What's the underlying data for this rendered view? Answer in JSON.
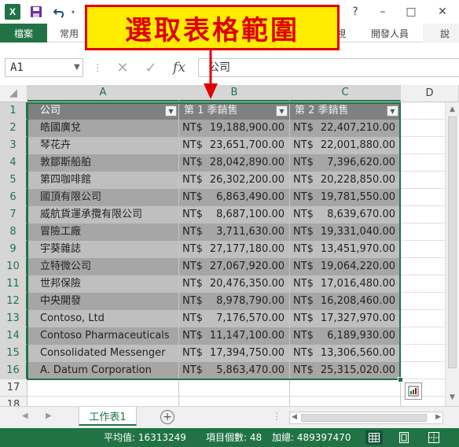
{
  "titlebar": {
    "logo": "X",
    "help": "?",
    "minimize": "–",
    "restore": "□",
    "close": "✕"
  },
  "ribbon": {
    "tabs": {
      "file": "檔案",
      "home": "常用",
      "view": "視",
      "developer": "開發人員",
      "last": "說"
    }
  },
  "callout": {
    "text": "選取表格範圍",
    "color": "#e00000",
    "background": "#ffed00"
  },
  "formula_bar": {
    "name_box": "A1",
    "formula": "公司",
    "cancel": "✕",
    "enter": "✓",
    "fx": "fx"
  },
  "columns": [
    "A",
    "B",
    "C",
    "D"
  ],
  "table": {
    "headers": [
      "公司",
      "第 1 季銷售",
      "第 2 季銷售"
    ],
    "currency": "NT$",
    "rows": [
      {
        "company": "皓國廣兌",
        "q1": "19,188,900.00",
        "q2": "22,407,210.00"
      },
      {
        "company": "琴花卉",
        "q1": "23,651,700.00",
        "q2": "22,001,880.00"
      },
      {
        "company": "敦鄒斯船舶",
        "q1": "28,042,890.00",
        "q2": "7,396,620.00"
      },
      {
        "company": "第四咖啡館",
        "q1": "26,302,200.00",
        "q2": "20,228,850.00"
      },
      {
        "company": "國頂有限公司",
        "q1": "6,863,490.00",
        "q2": "19,781,550.00"
      },
      {
        "company": "威航貨運承攬有限公司",
        "q1": "8,687,100.00",
        "q2": "8,639,670.00"
      },
      {
        "company": "冒險工廠",
        "q1": "3,711,630.00",
        "q2": "19,331,040.00"
      },
      {
        "company": "宇葵雜誌",
        "q1": "27,177,180.00",
        "q2": "13,451,970.00"
      },
      {
        "company": "立特微公司",
        "q1": "27,067,920.00",
        "q2": "19,064,220.00"
      },
      {
        "company": "世邦保險",
        "q1": "20,476,350.00",
        "q2": "17,016,480.00"
      },
      {
        "company": "中央開發",
        "q1": "8,978,790.00",
        "q2": "16,208,460.00"
      },
      {
        "company": "Contoso, Ltd",
        "q1": "7,176,570.00",
        "q2": "17,327,970.00"
      },
      {
        "company": "Contoso Pharmaceuticals",
        "q1": "11,147,100.00",
        "q2": "6,189,930.00"
      },
      {
        "company": "Consolidated Messenger",
        "q1": "17,394,750.00",
        "q2": "13,306,560.00"
      },
      {
        "company": "A. Datum Corporation",
        "q1": "5,863,470.00",
        "q2": "25,315,020.00"
      }
    ]
  },
  "row_numbers": [
    "1",
    "2",
    "3",
    "4",
    "5",
    "6",
    "7",
    "8",
    "9",
    "10",
    "11",
    "12",
    "13",
    "14",
    "15",
    "16",
    "17",
    "18"
  ],
  "sheet_tabs": {
    "active": "工作表1",
    "add": "+"
  },
  "status_bar": {
    "average": "平均值: 16313249",
    "count": "項目個數: 48",
    "sum": "加總: 489397470"
  },
  "colors": {
    "excel_green": "#217346",
    "table_header": "#808080",
    "band_dark": "#a6a6a6",
    "band_light": "#bfbfbf"
  },
  "icons": [
    "excel-logo-icon",
    "save-icon",
    "undo-icon",
    "help-icon",
    "filter-dropdown-icon",
    "quick-analysis-icon",
    "fx-icon",
    "normal-view-icon",
    "page-layout-icon",
    "page-break-icon"
  ]
}
